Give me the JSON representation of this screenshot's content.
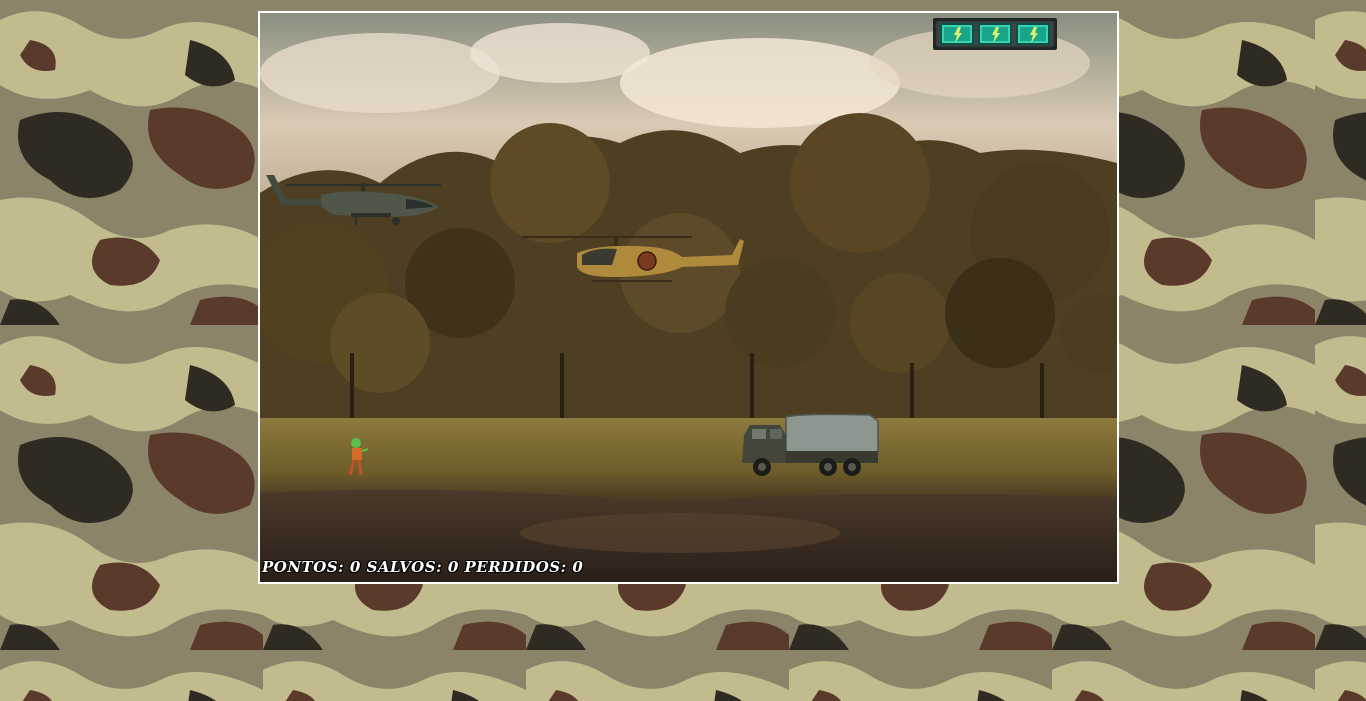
{
  "hud": {
    "pontos_label": "PONTOS:",
    "pontos_value": "0",
    "salvos_label": "SALVOS:",
    "salvos_value": "0",
    "perdidos_label": "PERDIDOS:",
    "perdidos_value": "0"
  },
  "energy": {
    "cells": 3,
    "icon": "lightning-bolt-icon"
  },
  "sprites": {
    "player": "player-helicopter",
    "enemy": "enemy-helicopter",
    "truck": "army-truck",
    "friend": "soldier-friend"
  },
  "colors": {
    "camo_base": "#8c8468",
    "camo_light": "#c2bb8d",
    "camo_brown": "#5a3a2a",
    "camo_dark": "#2f2a22",
    "energy_cell": "#18a58c"
  }
}
